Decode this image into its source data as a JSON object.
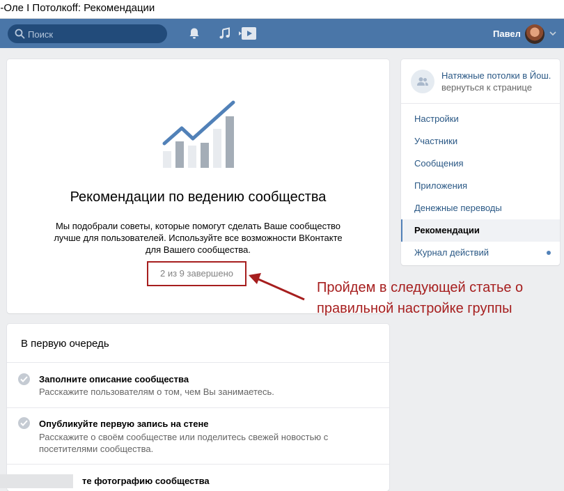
{
  "window": {
    "title": "о-Оле I Потолкоff: Рекомендации"
  },
  "header": {
    "search_placeholder": "Поиск",
    "user_name": "Павел",
    "icons": [
      "search-icon",
      "bell-icon",
      "music-icon",
      "video-icon",
      "chevron-down-icon"
    ]
  },
  "main": {
    "title": "Рекомендации по ведению сообщества",
    "description": "Мы подобрали советы, которые помогут сделать Ваше сообщество лучше для пользователей. Используйте все возможности ВКонтакте для Вашего сообщества.",
    "progress": "2 из 9 завершено"
  },
  "tasks": {
    "heading": "В первую очередь",
    "items": [
      {
        "title": "Заполните описание сообщества",
        "desc": "Расскажите пользователям о том, чем Вы занимаетесь."
      },
      {
        "title": "Опубликуйте первую запись на стене",
        "desc": "Расскажите о своём сообществе или поделитесь свежей новостью с посетителями сообщества."
      },
      {
        "title": "те фотографию сообщества",
        "desc": ""
      }
    ]
  },
  "sidebar": {
    "community_name": "Натяжные потолки в Йош.",
    "back_link": "вернуться к странице",
    "items": [
      {
        "label": "Настройки"
      },
      {
        "label": "Участники"
      },
      {
        "label": "Сообщения"
      },
      {
        "label": "Приложения"
      },
      {
        "label": "Денежные переводы"
      },
      {
        "label": "Рекомендации"
      },
      {
        "label": "Журнал действий"
      }
    ]
  },
  "annotation": {
    "text": "Пройдем в следующей статье о правильной настройке группы"
  },
  "colors": {
    "header": "#4a76a8",
    "link": "#2a5885",
    "annotation": "#a61e1e"
  }
}
